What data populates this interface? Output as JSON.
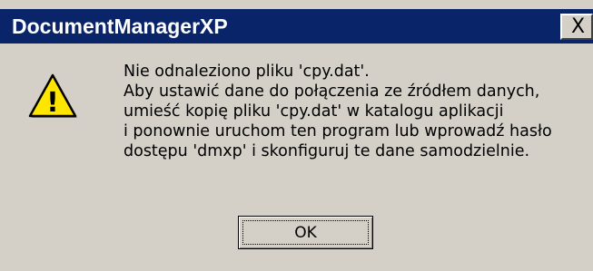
{
  "window": {
    "title": "DocumentManagerXP",
    "close_glyph": "X"
  },
  "icon": {
    "name": "warning-icon",
    "glyph": "!",
    "fill_color": "#ffe600",
    "outline_color": "#000000"
  },
  "message": {
    "lines": [
      "Nie odnaleziono pliku 'cpy.dat'.",
      "Aby ustawić dane do połączenia ze źródłem danych,",
      "umieść kopię pliku 'cpy.dat' w katalogu aplikacji",
      "i ponownie uruchom ten program lub wprowadź hasło",
      "dostępu 'dmxp' i skonfiguruj te dane samodzielnie."
    ]
  },
  "buttons": {
    "ok_label": "OK"
  },
  "colors": {
    "titlebar": "#0a246a",
    "dialog_bg": "#d4d0c8"
  }
}
